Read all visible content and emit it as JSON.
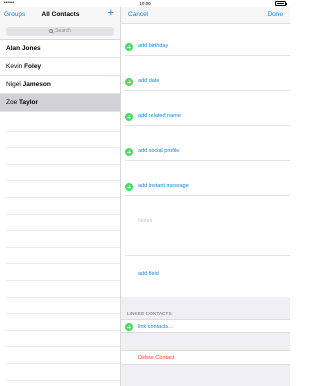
{
  "status_bar": {
    "signal": "•••••",
    "time": "10:00"
  },
  "left_pane": {
    "groups_label": "Groups",
    "title": "All Contacts",
    "add_label": "+",
    "search_placeholder": "Search",
    "contacts": [
      {
        "first": "Alan Jones",
        "last": ""
      },
      {
        "first": "Kevin ",
        "last": "Foley"
      },
      {
        "first": "Nigel ",
        "last": "Jameson"
      },
      {
        "first": "Zoe ",
        "last": "Taylor"
      }
    ]
  },
  "right_pane": {
    "cancel_label": "Cancel",
    "done_label": "Done",
    "add_rows": [
      {
        "label": "add birthday"
      },
      {
        "label": "add date"
      },
      {
        "label": "add related name"
      },
      {
        "label": "add social profile"
      },
      {
        "label": "add instant message"
      }
    ],
    "notes_placeholder": "Notes",
    "add_field_label": "add field",
    "linked_header": "LINKED CONTACTS",
    "link_contacts_label": "link contacts...",
    "delete_label": "Delete Contact"
  },
  "colors": {
    "accent": "#1a82e2",
    "add_green": "#4cd964",
    "delete_red": "#ff3b30",
    "selected_row": "#d1d1d6"
  }
}
